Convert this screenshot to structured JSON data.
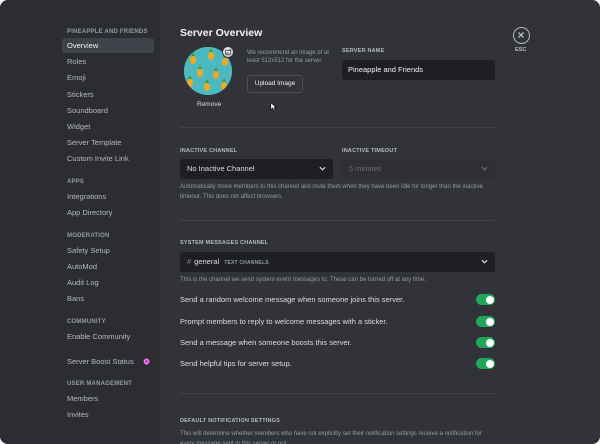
{
  "sidebar": {
    "server_heading": "PINEAPPLE AND FRIENDS",
    "server_items": [
      {
        "label": "Overview"
      },
      {
        "label": "Roles"
      },
      {
        "label": "Emoji"
      },
      {
        "label": "Stickers"
      },
      {
        "label": "Soundboard"
      },
      {
        "label": "Widget"
      },
      {
        "label": "Server Template"
      },
      {
        "label": "Custom Invite Link"
      }
    ],
    "apps_heading": "APPS",
    "apps_items": [
      {
        "label": "Integrations"
      },
      {
        "label": "App Directory"
      }
    ],
    "moderation_heading": "MODERATION",
    "moderation_items": [
      {
        "label": "Safety Setup"
      },
      {
        "label": "AutoMod"
      },
      {
        "label": "Audit Log"
      },
      {
        "label": "Bans"
      }
    ],
    "community_heading": "COMMUNITY",
    "community_items": [
      {
        "label": "Enable Community"
      }
    ],
    "boost_label": "Server Boost Status",
    "user_mgmt_heading": "USER MANAGEMENT",
    "user_mgmt_items": [
      {
        "label": "Members"
      },
      {
        "label": "Invites"
      }
    ]
  },
  "overview": {
    "title": "Server Overview",
    "icon_recommendation": "We recommend an image of at least 512x512 for the server.",
    "upload_button": "Upload Image",
    "remove_link": "Remove",
    "server_name_label": "SERVER NAME",
    "server_name_value": "Pineapple and Friends",
    "inactive_channel_label": "INACTIVE CHANNEL",
    "inactive_channel_value": "No Inactive Channel",
    "inactive_timeout_label": "INACTIVE TIMEOUT",
    "inactive_timeout_value": "5 minutes",
    "inactive_help": "Automatically move members to this channel and mute them when they have been idle for longer than the inactive timeout. This does not affect browsers.",
    "system_channel_label": "SYSTEM MESSAGES CHANNEL",
    "system_channel_value": "general",
    "system_channel_category": "TEXT CHANNELS",
    "system_channel_help": "This is the channel we send system event messages to. These can be turned off at any time.",
    "toggles": [
      {
        "label": "Send a random welcome message when someone joins this server.",
        "on": true
      },
      {
        "label": "Prompt members to reply to welcome messages with a sticker.",
        "on": true
      },
      {
        "label": "Send a message when someone boosts this server.",
        "on": true
      },
      {
        "label": "Send helpful tips for server setup.",
        "on": true
      }
    ],
    "notification_label": "DEFAULT NOTIFICATION SETTINGS",
    "notification_help": "This will determine whether members who have not explicitly set their notification settings receive a notification for every message sent in this server or not."
  },
  "close": {
    "label": "ESC"
  },
  "colors": {
    "accent_green": "#23a55a",
    "boost_pink": "#ff73fa",
    "background": "#313338",
    "sidebar": "#2b2d31"
  }
}
